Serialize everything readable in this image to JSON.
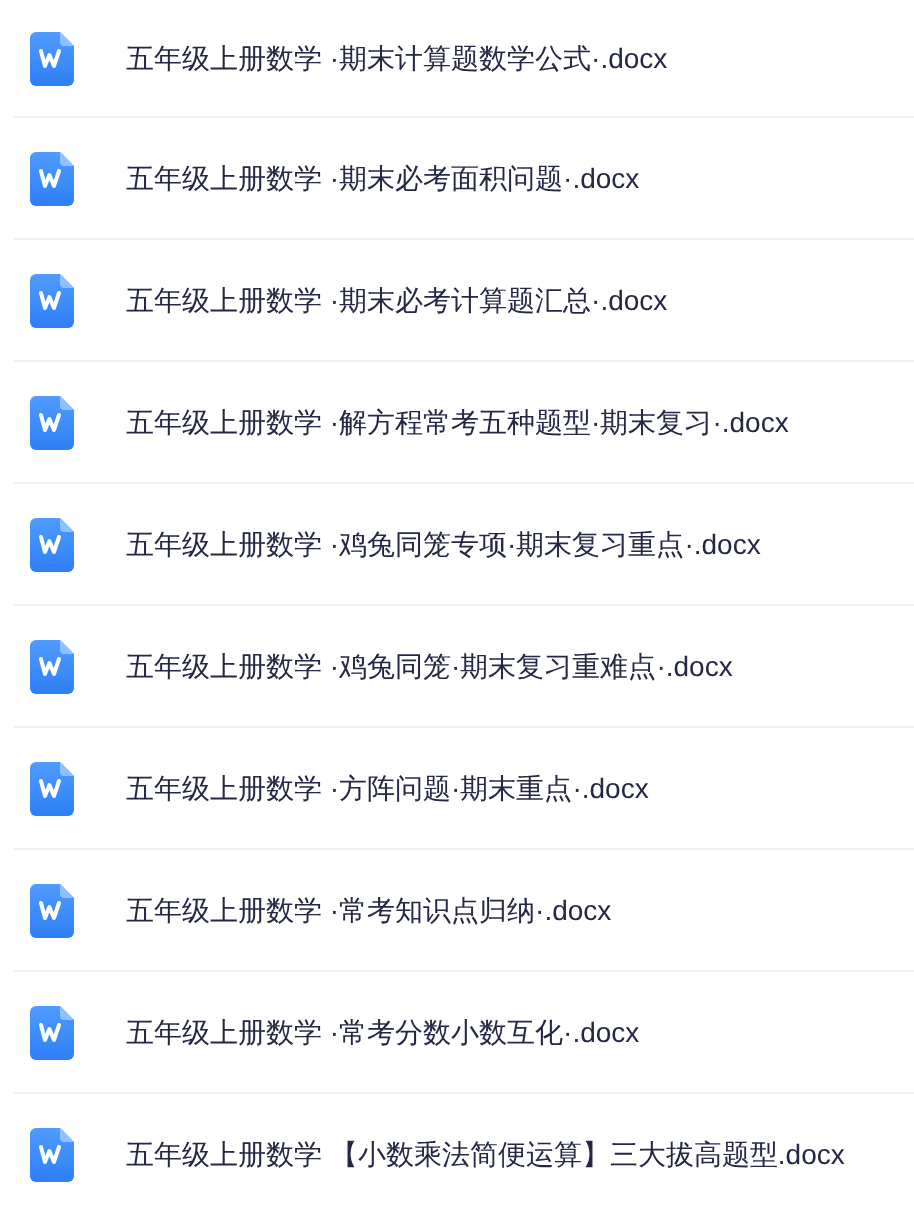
{
  "files": [
    {
      "name": "五年级上册数学 ·期末计算题数学公式·.docx"
    },
    {
      "name": "五年级上册数学 ·期末必考面积问题·.docx"
    },
    {
      "name": "五年级上册数学 ·期末必考计算题汇总·.docx"
    },
    {
      "name": "五年级上册数学 ·解方程常考五种题型·期末复习·.docx"
    },
    {
      "name": "五年级上册数学 ·鸡兔同笼专项·期末复习重点·.docx"
    },
    {
      "name": "五年级上册数学 ·鸡兔同笼·期末复习重难点·.docx"
    },
    {
      "name": "五年级上册数学 ·方阵问题·期末重点·.docx"
    },
    {
      "name": "五年级上册数学 ·常考知识点归纳·.docx"
    },
    {
      "name": "五年级上册数学 ·常考分数小数互化·.docx"
    },
    {
      "name": "五年级上册数学 【小数乘法简便运算】三大拔高题型.docx"
    }
  ]
}
